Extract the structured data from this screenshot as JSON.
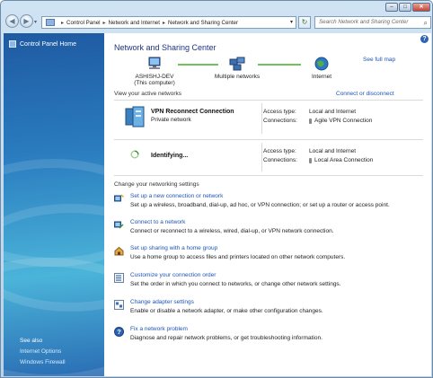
{
  "address_bar": {
    "breadcrumbs": [
      "Control Panel",
      "Network and Internet",
      "Network and Sharing Center"
    ],
    "search_placeholder": "Search Network and Sharing Center"
  },
  "sidebar": {
    "home": "Control Panel Home",
    "see_also_heading": "See also",
    "see_also_links": [
      "Internet Options",
      "Windows Firewall"
    ]
  },
  "main": {
    "title": "Network and Sharing Center",
    "see_full_map": "See full map",
    "map": {
      "computer_name": "ASHISHJ-DEV",
      "computer_sub": "(This computer)",
      "middle": "Multiple networks",
      "internet": "Internet"
    },
    "active_networks_label": "View your active networks",
    "connect_disconnect": "Connect or disconnect",
    "networks": [
      {
        "name": "VPN Reconnect Connection",
        "type": "Private network",
        "access_type_label": "Access type:",
        "access_type": "Local and Internet",
        "connections_label": "Connections:",
        "connection": "Agile VPN Connection"
      },
      {
        "name": "Identifying...",
        "type": "",
        "access_type_label": "Access type:",
        "access_type": "Local and Internet",
        "connections_label": "Connections:",
        "connection": "Local Area Connection"
      }
    ],
    "change_settings_label": "Change your networking settings",
    "tasks": [
      {
        "title": "Set up a new connection or network",
        "desc": "Set up a wireless, broadband, dial-up, ad hoc, or VPN connection; or set up a router or access point.",
        "icon": "new-connection-icon"
      },
      {
        "title": "Connect to a network",
        "desc": "Connect or reconnect to a wireless, wired, dial-up, or VPN network connection.",
        "icon": "connect-network-icon"
      },
      {
        "title": "Set up sharing with a home group",
        "desc": "Use a home group to access files and printers located on other network computers.",
        "icon": "homegroup-icon"
      },
      {
        "title": "Customize your connection order",
        "desc": "Set the order in which you connect to networks, or change other network settings.",
        "icon": "connection-order-icon"
      },
      {
        "title": "Change adapter settings",
        "desc": "Enable or disable a network adapter, or make other configuration changes.",
        "icon": "adapter-settings-icon"
      },
      {
        "title": "Fix a network problem",
        "desc": "Diagnose and repair network problems, or get troubleshooting information.",
        "icon": "troubleshoot-icon"
      }
    ]
  }
}
